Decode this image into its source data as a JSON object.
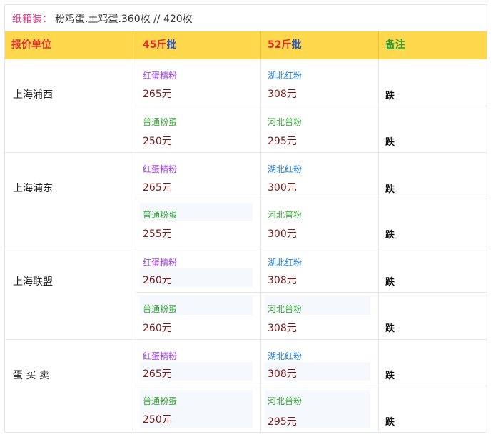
{
  "title": {
    "label": "纸箱装：",
    "text": "粉鸡蛋.土鸡蛋.360枚 // 420枚"
  },
  "header": {
    "col1": "报价单位",
    "col2_num": "45斤",
    "col2_suffix": "批",
    "col3_num": "52斤",
    "col3_suffix": "批",
    "col4": "备注"
  },
  "rows": [
    {
      "location": "上海浦西",
      "sub": [
        {
          "p45": "红蛋精粉",
          "v45": "265元",
          "p52": "湖北红粉",
          "v52": "308元",
          "remark": "跌"
        },
        {
          "p45": "普通粉蛋",
          "v45": "250元",
          "p52": "河北普粉",
          "v52": "295元",
          "remark": "跌"
        }
      ]
    },
    {
      "location": "上海浦东",
      "sub": [
        {
          "p45": "红蛋精粉",
          "v45": "265元",
          "p52": "湖北红粉",
          "v52": "300元",
          "remark": "跌"
        },
        {
          "p45": "普通粉蛋",
          "v45": "255元",
          "p52": "河北普粉",
          "v52": "300元",
          "remark": "跌"
        }
      ]
    },
    {
      "location": "上海联盟",
      "sub": [
        {
          "p45": "红蛋精粉",
          "v45": "260元",
          "p52": "湖北红粉",
          "v52": "308元",
          "remark": "跌"
        },
        {
          "p45": "普通粉蛋",
          "v45": "260元",
          "p52": "河北普粉",
          "v52": "308元",
          "remark": "跌"
        }
      ]
    },
    {
      "location": "蛋 买 卖",
      "sub": [
        {
          "p45": "红蛋精粉",
          "v45": "265元",
          "p52": "湖北红粉",
          "v52": "308元",
          "remark": "跌"
        },
        {
          "p45": "普通粉蛋",
          "v45": "250元",
          "p52": "河北普粉",
          "v52": "295元",
          "remark": "跌"
        }
      ]
    }
  ],
  "colors": {
    "header_bg": "#ffd84d",
    "header_col1": "#e0302e",
    "header_col2_num": "#e0302e",
    "header_suffix": "#2b57c9",
    "header_col4": "#2f9a2f",
    "title_label": "#d63384",
    "price": "#7a1a1a",
    "product_red_egg": "#a040e0",
    "product_hubei": "#1f7fd6",
    "product_green": "#3aa03a"
  }
}
